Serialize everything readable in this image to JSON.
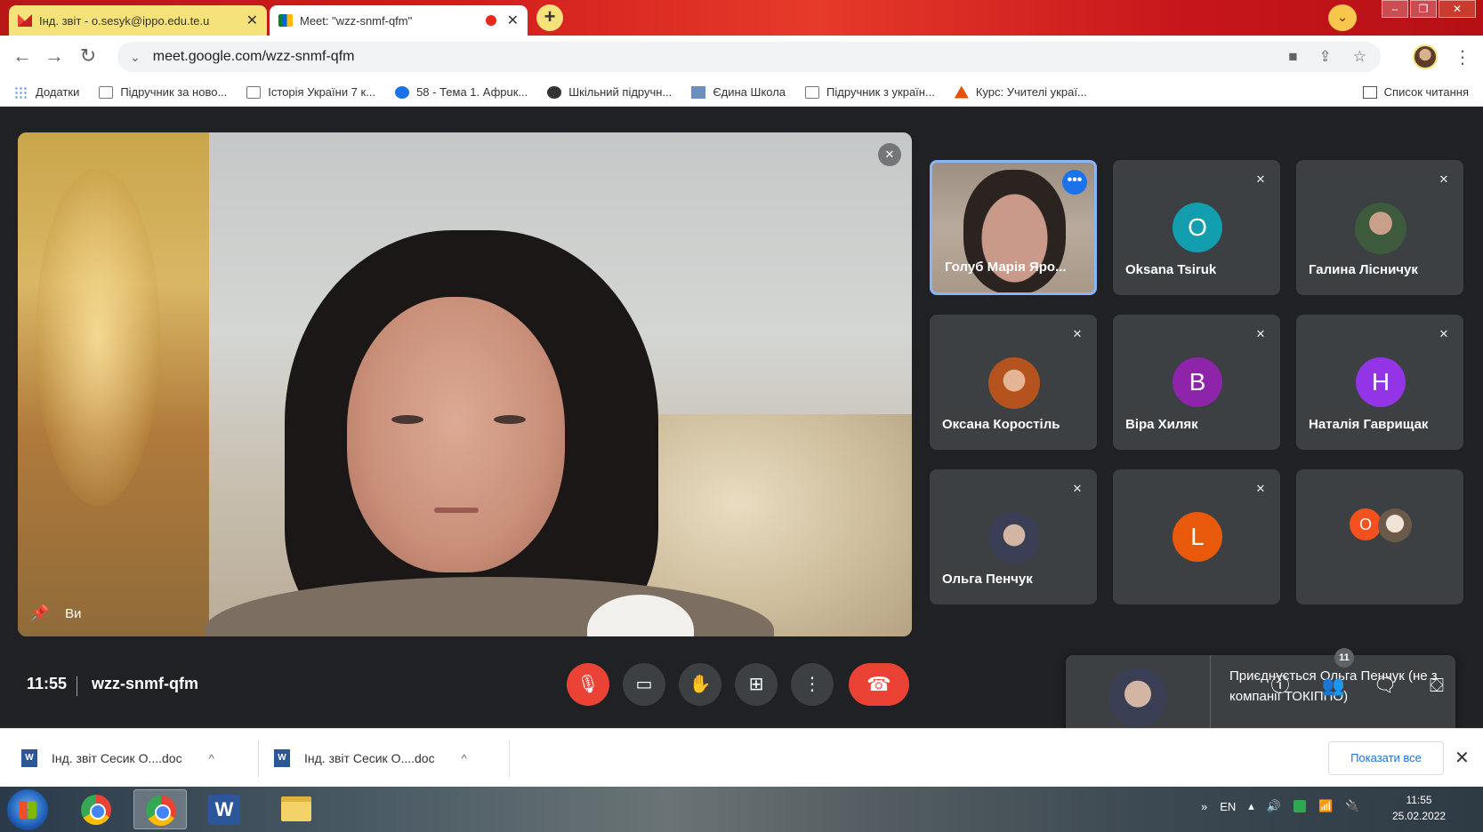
{
  "browser": {
    "tabs": [
      {
        "title": "Інд. звіт - o.sesyk@ippo.edu.te.u",
        "active": false,
        "close": "✕"
      },
      {
        "title": "Meet: \"wzz-snmf-qfm\"",
        "active": true,
        "close": "✕"
      }
    ],
    "new_tab": "+",
    "url": "meet.google.com/wzz-snmf-qfm",
    "bookmarks": [
      {
        "label": "Додатки",
        "icon": "apps-grid-icon"
      },
      {
        "label": "Підручник за ново...",
        "icon": "folder-icon"
      },
      {
        "label": "Історія України 7 к...",
        "icon": "folder-icon"
      },
      {
        "label": "58 - Тема 1. Афрuк...",
        "icon": "blue-circle-icon"
      },
      {
        "label": "Шкільний підручн...",
        "icon": "circle-icon"
      },
      {
        "label": "Єдина Школа",
        "icon": "doc-icon"
      },
      {
        "label": "Підручник з україн...",
        "icon": "folder-icon"
      },
      {
        "label": "Курс: Учителі украї...",
        "icon": "triangle-icon"
      }
    ],
    "reading_list": "Список читання"
  },
  "meet": {
    "main_label": "Ви",
    "participants": [
      {
        "name": "Голуб Марія Яро...",
        "type": "video",
        "highlighted": true
      },
      {
        "name": "Oksana Tsiruk",
        "type": "letter",
        "letter": "O",
        "color": "#129eaf"
      },
      {
        "name": "Галина Лісничук",
        "type": "photo"
      },
      {
        "name": "Оксана Коростіль",
        "type": "photo"
      },
      {
        "name": "Віра Хиляк",
        "type": "letter",
        "letter": "В",
        "color": "#8e24aa"
      },
      {
        "name": "Наталія Гаврищак",
        "type": "letter",
        "letter": "Н",
        "color": "#9334e6"
      },
      {
        "name": "Ольга Пенчук",
        "type": "photo"
      },
      {
        "name": "",
        "type": "letter",
        "letter": "L",
        "color": "#e8590c"
      },
      {
        "name": "",
        "type": "group",
        "letter": "O",
        "color": "#f4511e"
      }
    ],
    "toast": "Приєднується Ольга Пенчук (не з компанії ТОКІППО)",
    "time": "11:55",
    "code": "wzz-snmf-qfm",
    "people_count": "11",
    "more_dots": "•••"
  },
  "downloads": {
    "items": [
      {
        "label": "Інд. звіт Сесик О....doc"
      },
      {
        "label": "Інд. звіт Сесик О....doc"
      }
    ],
    "show_all": "Показати все"
  },
  "taskbar": {
    "lang": "EN",
    "time": "11:55",
    "date": "25.02.2022"
  }
}
